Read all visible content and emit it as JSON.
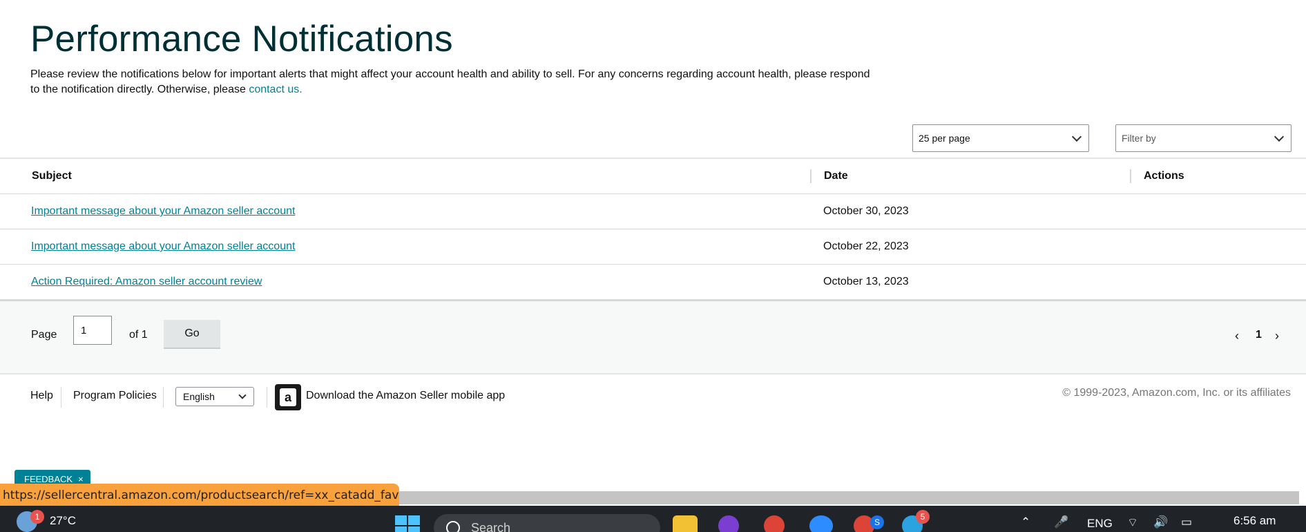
{
  "header": {
    "title": "Performance Notifications",
    "intro_text": "Please review the notifications below for important alerts that might affect your account health and ability to sell. For any concerns regarding account health, please respond to the notification directly. Otherwise, please ",
    "contact_link": "contact us."
  },
  "controls": {
    "per_page": "25 per page",
    "filter_placeholder": "Filter by"
  },
  "table": {
    "columns": [
      "Subject",
      "Date",
      "Actions"
    ],
    "rows": [
      {
        "subject": "Important message about your Amazon seller account",
        "date": "October 30, 2023"
      },
      {
        "subject": "Important message about your Amazon seller account",
        "date": "October 22, 2023"
      },
      {
        "subject": "Action Required: Amazon seller account review",
        "date": "October 13, 2023"
      }
    ]
  },
  "pagination": {
    "page_label": "Page",
    "page_value": "1",
    "of_label": "of 1",
    "go_label": "Go",
    "prev": "‹",
    "current": "1",
    "next": "›"
  },
  "footer": {
    "help": "Help",
    "policies": "Program Policies",
    "language": "English",
    "app_icon_glyph": "a",
    "app_text": "Download the Amazon Seller mobile app",
    "copyright": "© 1999-2023, Amazon.com, Inc. or its affiliates"
  },
  "feedback": {
    "label": "FEEDBACK",
    "close": "×"
  },
  "status_url": "https://sellercentral.amazon.com/productsearch/ref=xx_catadd_favb_xx",
  "taskbar": {
    "weather_badge": "1",
    "temperature": "27°C",
    "search_placeholder": "Search",
    "chrome_badge": "S",
    "telegram_badge": "5",
    "language": "ENG",
    "time": "6:56 am"
  },
  "colors": {
    "link": "#008296",
    "title": "#002f36",
    "status_bar": "#f9a23d"
  }
}
